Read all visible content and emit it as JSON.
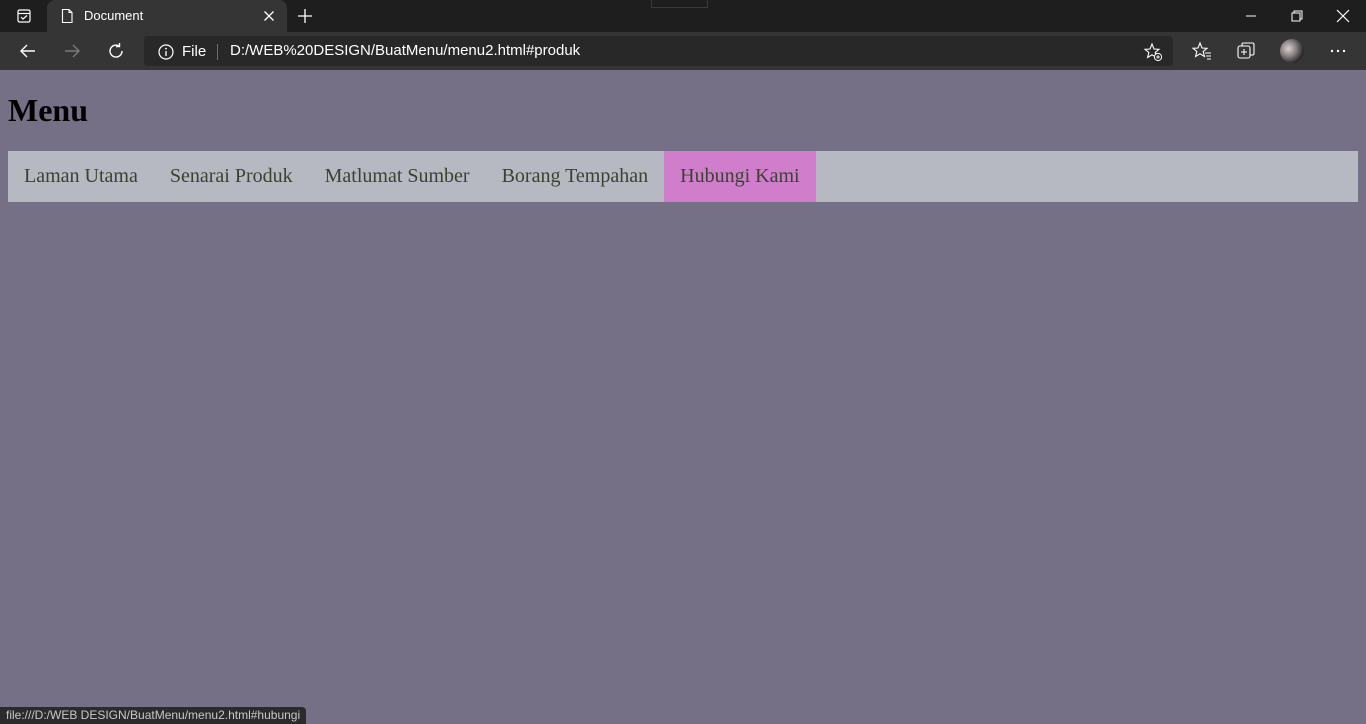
{
  "browser": {
    "tab": {
      "title": "Document"
    },
    "address": {
      "site_info_label": "File",
      "url": "D:/WEB%20DESIGN/BuatMenu/menu2.html#produk"
    },
    "status_url": "file:///D:/WEB DESIGN/BuatMenu/menu2.html#hubungi"
  },
  "page": {
    "heading": "Menu",
    "menu": {
      "background": "#b6b9c1",
      "hover_color": "#d07ecc",
      "items": [
        {
          "label": "Laman Utama"
        },
        {
          "label": "Senarai Produk"
        },
        {
          "label": "Matlumat Sumber"
        },
        {
          "label": "Borang Tempahan"
        },
        {
          "label": "Hubungi Kami",
          "active": true
        }
      ]
    },
    "background": "#757085"
  },
  "icons": {
    "tab_actions": "tab-actions-icon",
    "page": "page-icon",
    "close": "close-icon",
    "new_tab": "plus-icon",
    "back": "back-arrow-icon",
    "forward": "forward-arrow-icon",
    "refresh": "refresh-icon",
    "info": "info-icon",
    "add_favorite": "star-plus-icon",
    "favorites": "favorites-icon",
    "collections": "collections-icon",
    "more": "more-icon"
  }
}
